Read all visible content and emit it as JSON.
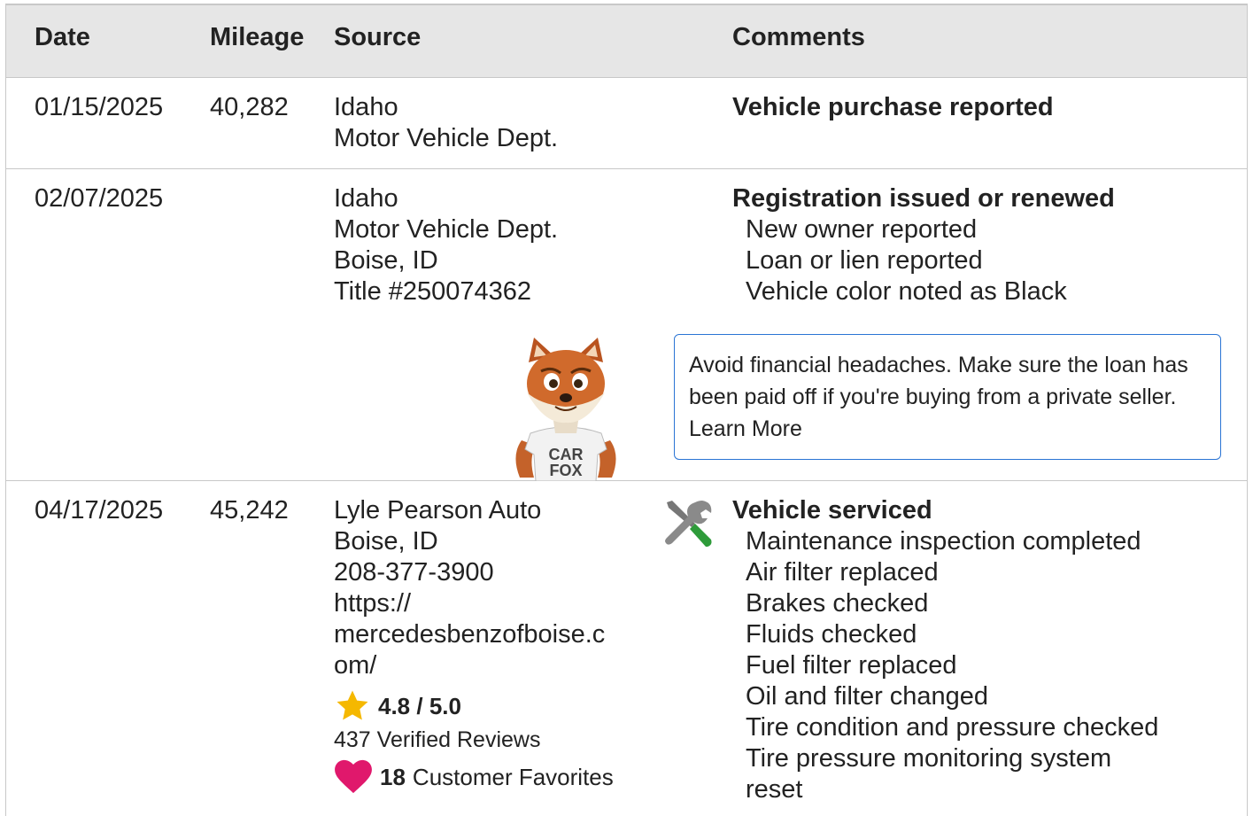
{
  "headers": {
    "date": "Date",
    "mileage": "Mileage",
    "source": "Source",
    "comments": "Comments"
  },
  "rows": [
    {
      "date": "01/15/2025",
      "mileage": "40,282",
      "source": [
        "Idaho",
        "Motor Vehicle Dept."
      ],
      "comment_title": "Vehicle purchase reported",
      "comment_items": []
    },
    {
      "date": "02/07/2025",
      "mileage": "",
      "source": [
        "Idaho",
        "Motor Vehicle Dept.",
        "Boise, ID",
        "Title #250074362"
      ],
      "comment_title": "Registration issued or renewed",
      "comment_items": [
        "New owner reported",
        "Loan or lien reported",
        "Vehicle color noted as Black"
      ],
      "tip": {
        "text": "Avoid financial headaches. Make sure the loan has been paid off if you're buying from a private seller.",
        "link": "Learn More"
      },
      "mascot_shirt": [
        "CAR",
        "FOX"
      ]
    },
    {
      "date": "04/17/2025",
      "mileage": "45,242",
      "source": [
        "Lyle Pearson Auto",
        "Boise, ID",
        "208-377-3900",
        "https://",
        "mercedesbenzofboise.c",
        "om/"
      ],
      "rating": "4.8 / 5.0",
      "reviews": "437 Verified Reviews",
      "favorites_count": "18",
      "favorites_label": "Customer Favorites",
      "comment_title": "Vehicle serviced",
      "comment_items": [
        "Maintenance inspection completed",
        "Air filter replaced",
        "Brakes checked",
        "Fluids checked",
        "Fuel filter replaced",
        "Oil and filter changed",
        "Tire condition and pressure checked",
        "Tire pressure monitoring system",
        "reset"
      ],
      "icon": "tools-icon"
    }
  ],
  "colors": {
    "header_bg": "#e6e6e6",
    "border": "#c8c8c8",
    "tip_border": "#2a74d4",
    "star": "#f5b800",
    "heart": "#e0186c",
    "wrench_green": "#2e9b3a"
  }
}
